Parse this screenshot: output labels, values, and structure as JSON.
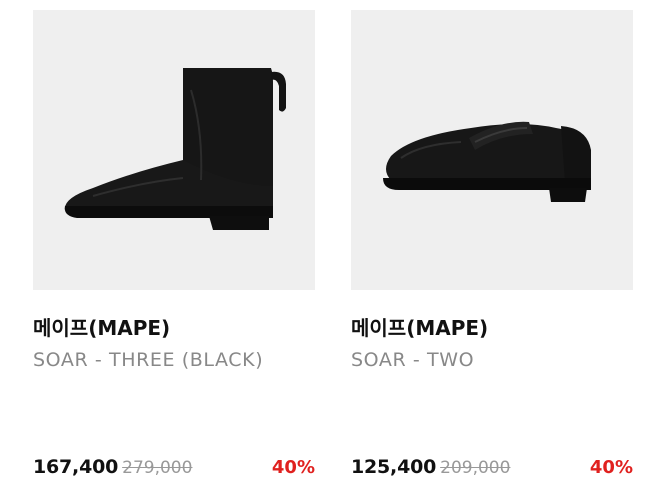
{
  "products": [
    {
      "brand": "메이프(MAPE)",
      "name": "SOAR - THREE (BLACK)",
      "price": "167,400",
      "original_price": "279,000",
      "discount": "40%",
      "image_icon": "ankle-boot-image"
    },
    {
      "brand": "메이프(MAPE)",
      "name": "SOAR - TWO",
      "price": "125,400",
      "original_price": "209,000",
      "discount": "40%",
      "image_icon": "loafer-image"
    }
  ],
  "colors": {
    "image_background": "#efefef",
    "discount": "#e0211f",
    "muted_text": "#888888",
    "strike_text": "#999999"
  }
}
